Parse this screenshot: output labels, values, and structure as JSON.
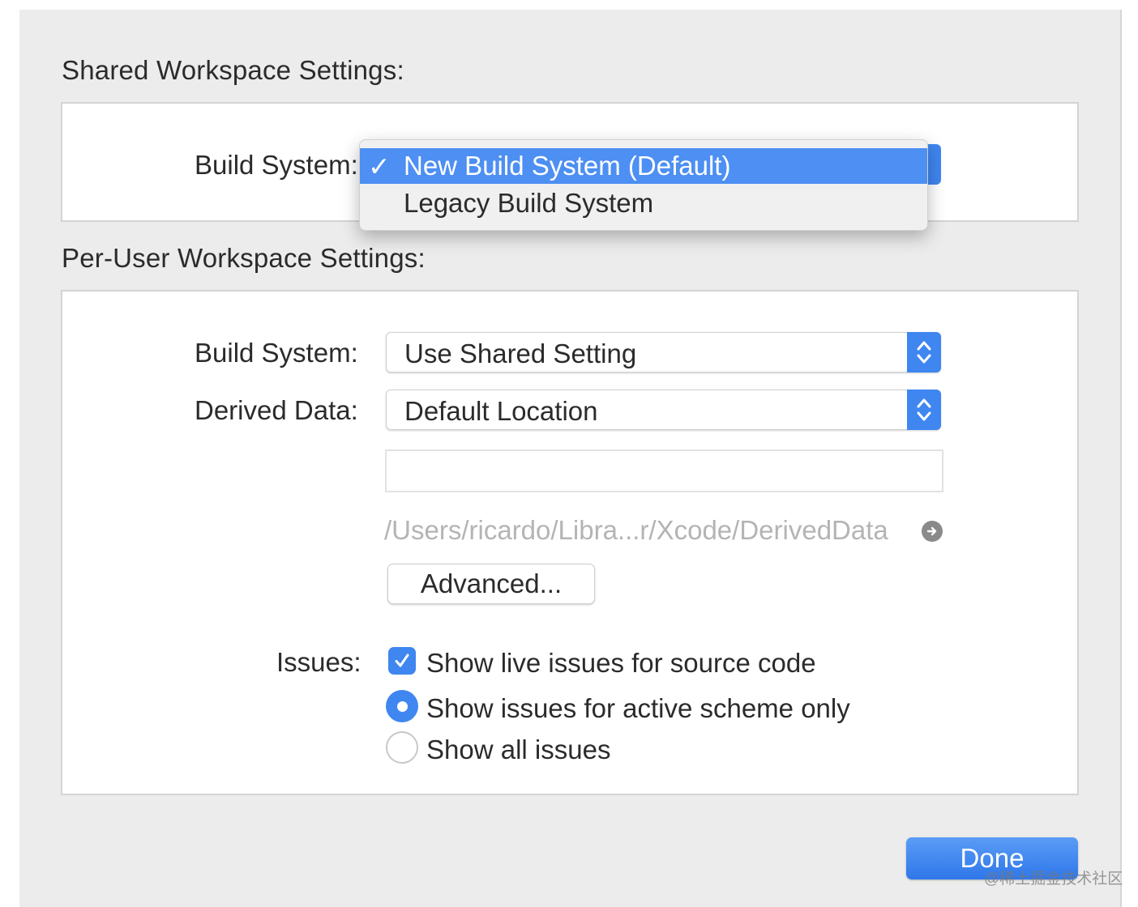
{
  "shared": {
    "title": "Shared Workspace Settings:",
    "build_system_label": "Build System:",
    "menu": {
      "check_glyph": "✓",
      "items": [
        {
          "label": "New Build System (Default)",
          "selected": true
        },
        {
          "label": "Legacy Build System",
          "selected": false
        }
      ]
    }
  },
  "per_user": {
    "title": "Per-User Workspace Settings:",
    "build_system_label": "Build System:",
    "build_system_value": "Use Shared Setting",
    "derived_data_label": "Derived Data:",
    "derived_data_value": "Default Location",
    "custom_path_value": "",
    "derived_path": "/Users/ricardo/Libra...r/Xcode/DerivedData",
    "advanced_label": "Advanced...",
    "issues_label": "Issues:",
    "issues": {
      "live_issues": {
        "label": "Show live issues for source code",
        "checked": true
      },
      "active_scheme_only": {
        "label": "Show issues for active scheme only",
        "selected": true
      },
      "all_issues": {
        "label": "Show all issues",
        "selected": false
      }
    }
  },
  "done_label": "Done",
  "watermark": "@稀土掘金技术社区",
  "colors": {
    "accent": "#3f86f0",
    "menu_highlight": "#4d8ff2",
    "background": "#ececec"
  }
}
